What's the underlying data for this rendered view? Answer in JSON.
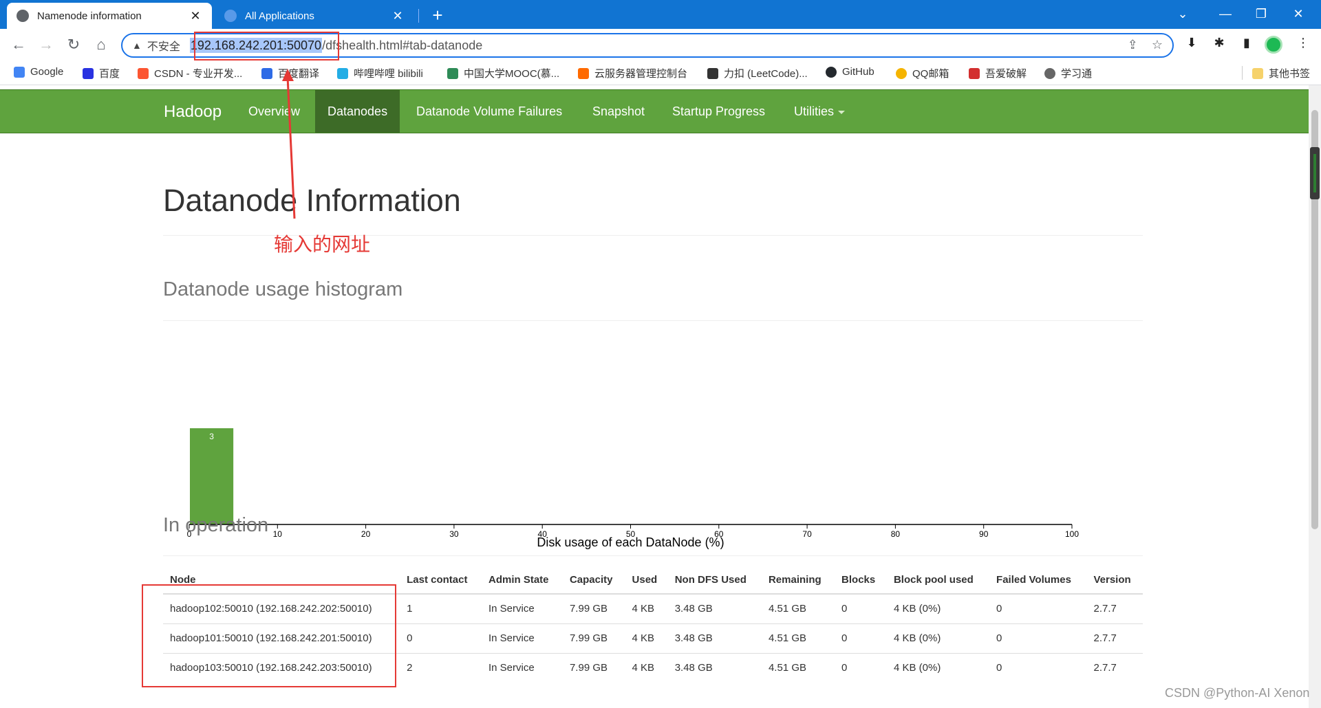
{
  "browser": {
    "tabs": [
      {
        "title": "Namenode information",
        "active": true
      },
      {
        "title": "All Applications",
        "active": false
      }
    ],
    "new_tab_symbol": "+",
    "security_label": "不安全",
    "url_host": "192.168.242.201:50070",
    "url_path": "/dfshealth.html#tab-datanode",
    "bookmarks": [
      "Google",
      "百度",
      "CSDN - 专业开发...",
      "百度翻译",
      "哔哩哔哩 bilibili",
      "中国大学MOOC(慕...",
      "云服务器管理控制台",
      "力扣 (LeetCode)...",
      "GitHub",
      "QQ邮箱",
      "吾爱破解",
      "学习通"
    ],
    "other_bookmarks": "其他书签"
  },
  "navbar": {
    "brand": "Hadoop",
    "items": [
      "Overview",
      "Datanodes",
      "Datanode Volume Failures",
      "Snapshot",
      "Startup Progress",
      "Utilities"
    ],
    "active": "Datanodes"
  },
  "page": {
    "title": "Datanode Information",
    "histogram_heading": "Datanode usage histogram",
    "operation_heading": "In operation"
  },
  "annotation": {
    "text": "输入的网址",
    "color": "#e53935"
  },
  "chart_data": {
    "type": "bar",
    "xlabel": "Disk usage of each DataNode (%)",
    "xlim": [
      0,
      100
    ],
    "x_ticks": [
      0,
      10,
      20,
      30,
      40,
      50,
      60,
      70,
      80,
      90,
      100
    ],
    "bins": [
      {
        "x0": 0,
        "x1": 5,
        "count": 3
      }
    ],
    "bar_color": "#5fa33e"
  },
  "table": {
    "columns": [
      "Node",
      "Last contact",
      "Admin State",
      "Capacity",
      "Used",
      "Non DFS Used",
      "Remaining",
      "Blocks",
      "Block pool used",
      "Failed Volumes",
      "Version"
    ],
    "rows": [
      [
        "hadoop102:50010 (192.168.242.202:50010)",
        "1",
        "In Service",
        "7.99 GB",
        "4 KB",
        "3.48 GB",
        "4.51 GB",
        "0",
        "4 KB (0%)",
        "0",
        "2.7.7"
      ],
      [
        "hadoop101:50010 (192.168.242.201:50010)",
        "0",
        "In Service",
        "7.99 GB",
        "4 KB",
        "3.48 GB",
        "4.51 GB",
        "0",
        "4 KB (0%)",
        "0",
        "2.7.7"
      ],
      [
        "hadoop103:50010 (192.168.242.203:50010)",
        "2",
        "In Service",
        "7.99 GB",
        "4 KB",
        "3.48 GB",
        "4.51 GB",
        "0",
        "4 KB (0%)",
        "0",
        "2.7.7"
      ]
    ]
  },
  "watermark": "CSDN @Python-AI Xenon"
}
